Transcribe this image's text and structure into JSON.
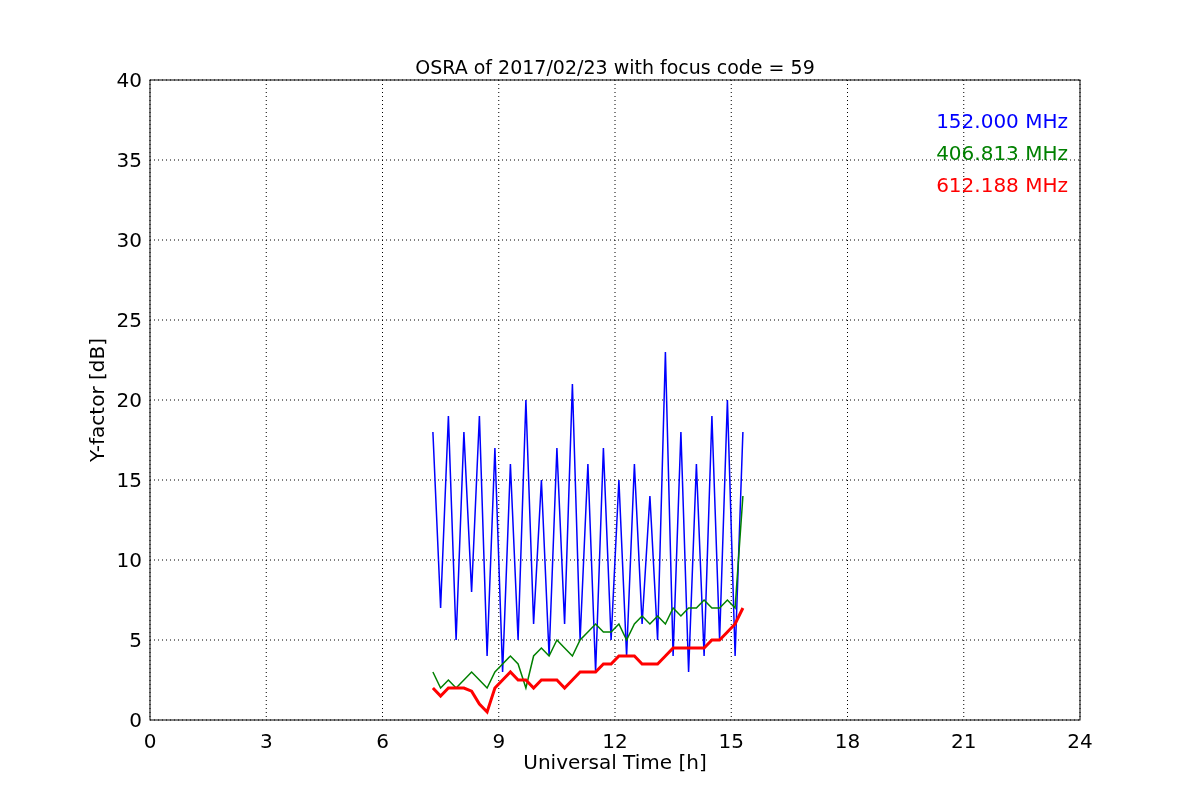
{
  "chart_data": {
    "type": "line",
    "title": "OSRA of 2017/02/23 with focus code = 59",
    "xlabel": "Universal Time [h]",
    "ylabel": "Y-factor [dB]",
    "x": [
      7.3,
      7.5,
      7.7,
      7.9,
      8.1,
      8.3,
      8.5,
      8.7,
      8.9,
      9.1,
      9.3,
      9.5,
      9.7,
      9.9,
      10.1,
      10.3,
      10.5,
      10.7,
      10.9,
      11.1,
      11.3,
      11.5,
      11.7,
      11.9,
      12.1,
      12.3,
      12.5,
      12.7,
      12.9,
      13.1,
      13.3,
      13.5,
      13.7,
      13.9,
      14.1,
      14.3,
      14.5,
      14.7,
      14.9,
      15.1,
      15.3
    ],
    "series": [
      {
        "name": "152.000 MHz",
        "color": "#0000ff",
        "values": [
          18,
          7,
          19,
          5,
          18,
          8,
          19,
          4,
          17,
          3,
          16,
          5,
          20,
          6,
          15,
          4,
          17,
          6,
          21,
          5,
          16,
          3,
          17,
          5,
          15,
          4,
          16,
          6,
          14,
          5,
          23,
          4,
          18,
          3,
          16,
          4,
          19,
          5,
          20,
          4,
          18
        ]
      },
      {
        "name": "406.813 MHz",
        "color": "#008000",
        "values": [
          3,
          2,
          2.5,
          2,
          2.5,
          3,
          2.5,
          2,
          3,
          3.5,
          4,
          3.5,
          2,
          4,
          4.5,
          4,
          5,
          4.5,
          4,
          5,
          5.5,
          6,
          5.5,
          5.5,
          6,
          5,
          6,
          6.5,
          6,
          6.5,
          6,
          7,
          6.5,
          7,
          7,
          7.5,
          7,
          7,
          7.5,
          7,
          14
        ]
      },
      {
        "name": "612.188 MHz",
        "color": "#ff0000",
        "values": [
          2,
          1.5,
          2,
          2,
          2,
          1.8,
          1,
          0.5,
          2,
          2.5,
          3,
          2.5,
          2.5,
          2,
          2.5,
          2.5,
          2.5,
          2,
          2.5,
          3,
          3,
          3,
          3.5,
          3.5,
          4,
          4,
          4,
          3.5,
          3.5,
          3.5,
          4,
          4.5,
          4.5,
          4.5,
          4.5,
          4.5,
          5,
          5,
          5.5,
          6,
          7
        ]
      }
    ],
    "grid": true,
    "xlim": [
      0,
      24
    ],
    "ylim": [
      0,
      40
    ],
    "xticks": [
      0,
      3,
      6,
      9,
      12,
      15,
      18,
      21,
      24
    ],
    "yticks": [
      0,
      5,
      10,
      15,
      20,
      25,
      30,
      35,
      40
    ]
  }
}
